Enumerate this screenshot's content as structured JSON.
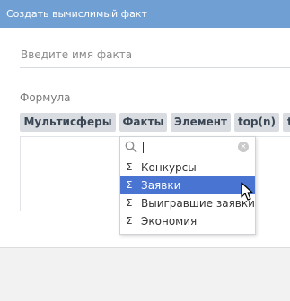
{
  "dialog": {
    "title": "Создать вычислимый факт",
    "name_input": {
      "placeholder": "Введите имя факта",
      "value": ""
    },
    "formula_label": "Формула",
    "chips": [
      "Мультисферы",
      "Факты",
      "Элемент",
      "top(n)",
      "t"
    ],
    "formula_value": ""
  },
  "dropdown": {
    "search_value": "",
    "items": [
      {
        "icon": "sigma-icon",
        "symbol": "Σ",
        "label": "Конкурсы",
        "selected": false
      },
      {
        "icon": "sigma-icon",
        "symbol": "Σ",
        "label": "Заявки",
        "selected": true
      },
      {
        "icon": "sigma-icon",
        "symbol": "Σ",
        "label": "Выигравшие заявки",
        "selected": false
      },
      {
        "icon": "sigma-icon",
        "symbol": "Σ",
        "label": "Экономия",
        "selected": false
      }
    ],
    "clear_symbol": "×"
  },
  "colors": {
    "titlebar": "#6f9fd3",
    "chip_bg": "#d9dde2",
    "selected_item": "#4a74d1"
  }
}
